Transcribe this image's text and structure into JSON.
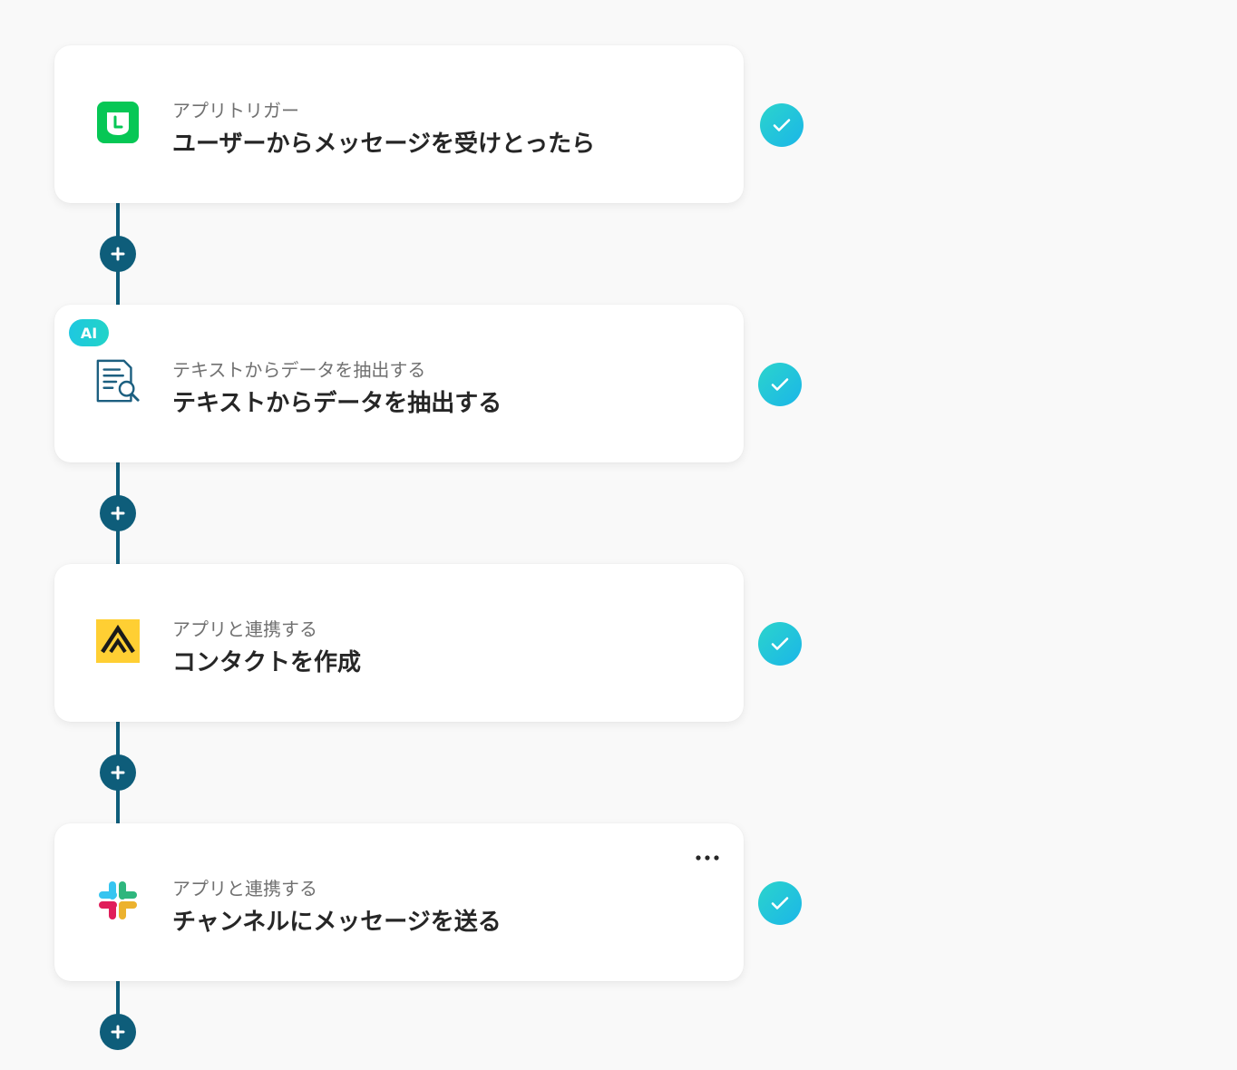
{
  "steps": [
    {
      "subtitle": "アプリトリガー",
      "title": "ユーザーからメッセージを受けとったら",
      "icon": "line-icon",
      "status": "completed"
    },
    {
      "badge": "AI",
      "subtitle": "テキストからデータを抽出する",
      "title": "テキストからデータを抽出する",
      "icon": "document-search-icon",
      "status": "completed"
    },
    {
      "subtitle": "アプリと連携する",
      "title": "コンタクトを作成",
      "icon": "app-logo-icon",
      "status": "completed"
    },
    {
      "subtitle": "アプリと連携する",
      "title": "チャンネルにメッセージを送る",
      "icon": "slack-icon",
      "status": "completed"
    }
  ],
  "colors": {
    "connector": "#0e5d7a",
    "check_gradient_start": "#2bd4cc",
    "check_gradient_end": "#1bb6e8",
    "line_green": "#06c755",
    "app_yellow": "#ffcf33"
  }
}
